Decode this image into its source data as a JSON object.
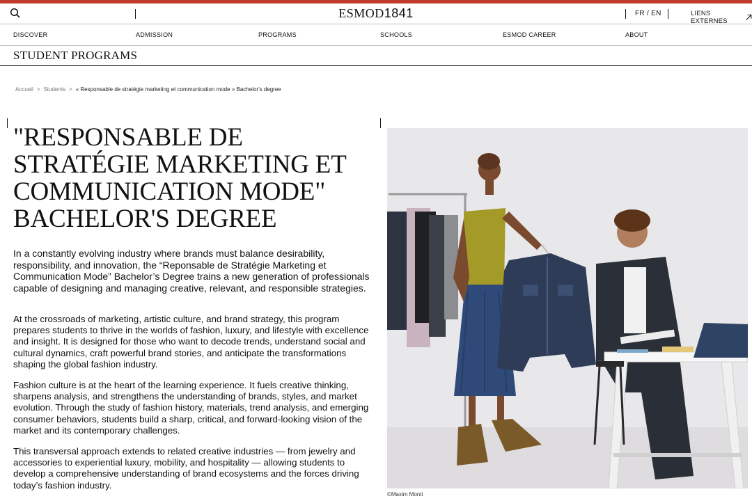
{
  "header": {
    "logo_part1": "ESMOD",
    "logo_part2": "1841",
    "language": "FR / EN",
    "external_links": "LIENS EXTERNES",
    "accent_color": "#c0392b"
  },
  "nav": {
    "items": [
      "DISCOVER",
      "ADMISSION",
      "PROGRAMS",
      "SCHOOLS",
      "ESMOD CAREER",
      "ABOUT"
    ]
  },
  "section": {
    "title": "STUDENT PROGRAMS"
  },
  "breadcrumb": {
    "items": [
      "Accueil",
      "Students",
      "« Responsable de stratégie marketing et communication mode » Bachelor's degree"
    ],
    "separator": ">"
  },
  "main": {
    "title": "\"RESPONSABLE DE STRATÉGIE MARKETING ET COMMUNICATION MODE\" BACHELOR'S DEGREE",
    "paragraphs": [
      "In a constantly evolving industry where brands must balance desirability, responsibility, and innovation, the “Reponsable de Stratégie Marketing et Communication Mode” Bachelor’s Degree trains a new generation of professionals capable of designing and managing creative, relevant, and responsible strategies.",
      "At the crossroads of marketing, artistic culture, and brand strategy, this program prepares students to thrive in the worlds of fashion, luxury, and lifestyle with excellence and insight. It is designed for those who want to decode trends, understand social and cultural dynamics, craft powerful brand stories, and anticipate the transformations shaping the global fashion industry.",
      "Fashion culture is at the heart of the learning experience. It fuels creative thinking, sharpens analysis, and strengthens the understanding of brands, styles, and market evolution. Through the study of fashion history, materials, trend analysis, and emerging consumer behaviors, students build a sharp, critical, and forward-looking vision of the market and its contemporary challenges.",
      "This transversal approach extends to related creative industries — from jewelry and accessories to experiential luxury, mobility, and hospitality — allowing students to develop a comprehensive understanding of brand ecosystems and the forces driving today’s fashion industry."
    ]
  },
  "image": {
    "credit": "©Maxim Monti"
  }
}
